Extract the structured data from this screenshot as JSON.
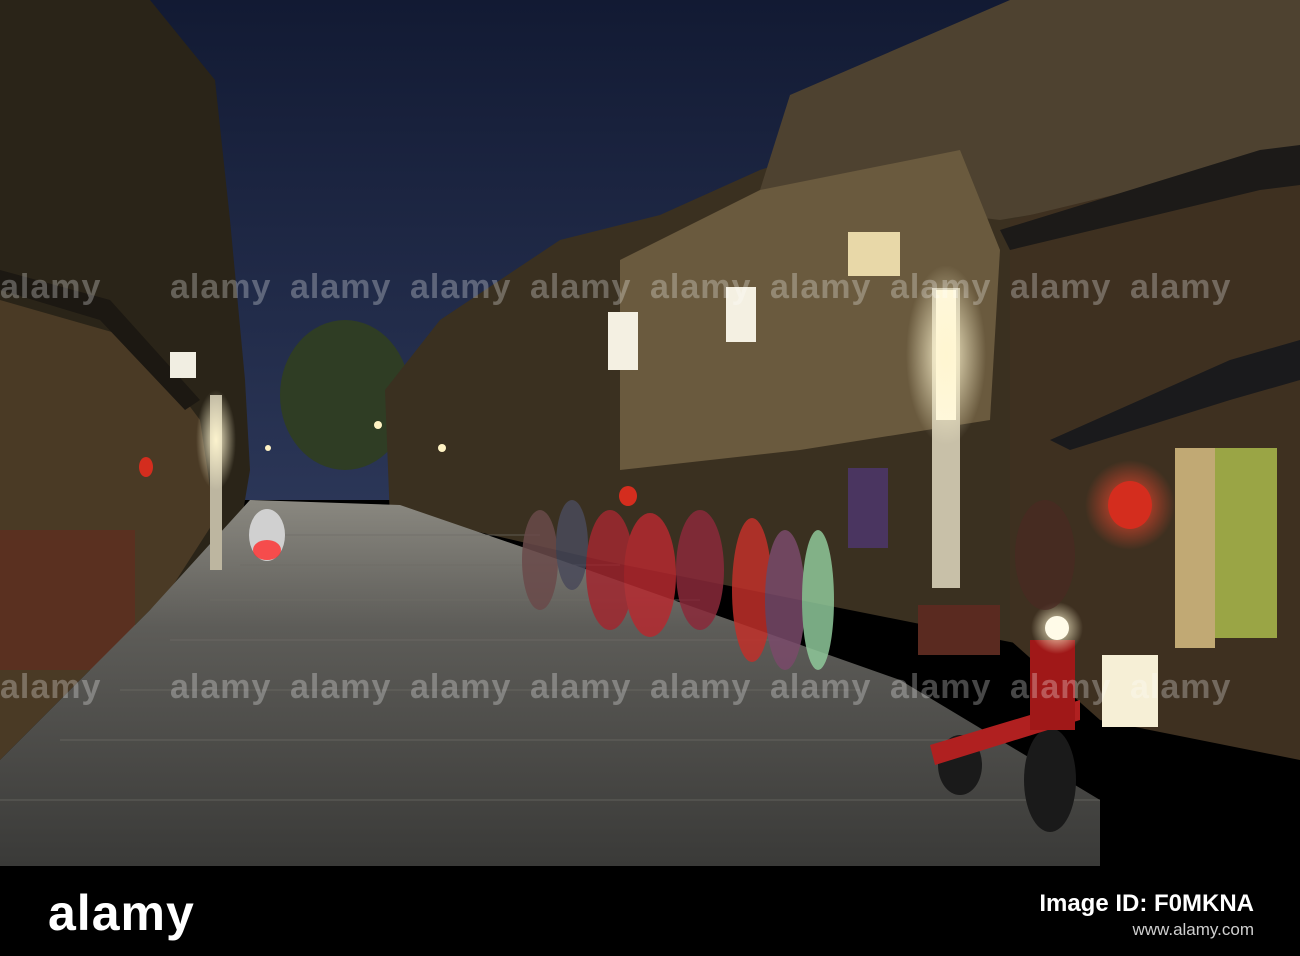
{
  "watermark": {
    "text": "alamy"
  },
  "footer": {
    "logo": "alamy",
    "image_id_label": "Image ID: F0MKNA",
    "url": "www.alamy.com"
  },
  "colors": {
    "sky": "#1b2440",
    "street": "#5b5a57",
    "lantern": "#d42d1e",
    "lamp": "#fff3c4"
  }
}
